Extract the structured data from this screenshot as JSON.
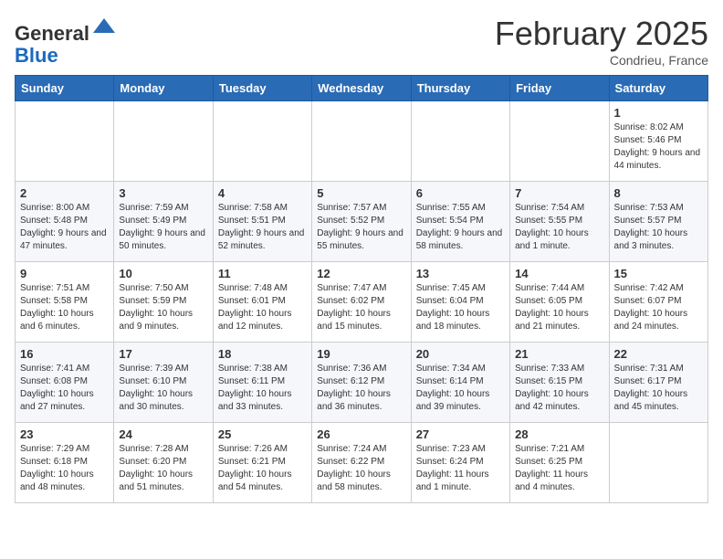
{
  "header": {
    "logo_line1": "General",
    "logo_line2": "Blue",
    "month": "February 2025",
    "location": "Condrieu, France"
  },
  "days_of_week": [
    "Sunday",
    "Monday",
    "Tuesday",
    "Wednesday",
    "Thursday",
    "Friday",
    "Saturday"
  ],
  "weeks": [
    [
      {
        "day": "",
        "info": ""
      },
      {
        "day": "",
        "info": ""
      },
      {
        "day": "",
        "info": ""
      },
      {
        "day": "",
        "info": ""
      },
      {
        "day": "",
        "info": ""
      },
      {
        "day": "",
        "info": ""
      },
      {
        "day": "1",
        "info": "Sunrise: 8:02 AM\nSunset: 5:46 PM\nDaylight: 9 hours and 44 minutes."
      }
    ],
    [
      {
        "day": "2",
        "info": "Sunrise: 8:00 AM\nSunset: 5:48 PM\nDaylight: 9 hours and 47 minutes."
      },
      {
        "day": "3",
        "info": "Sunrise: 7:59 AM\nSunset: 5:49 PM\nDaylight: 9 hours and 50 minutes."
      },
      {
        "day": "4",
        "info": "Sunrise: 7:58 AM\nSunset: 5:51 PM\nDaylight: 9 hours and 52 minutes."
      },
      {
        "day": "5",
        "info": "Sunrise: 7:57 AM\nSunset: 5:52 PM\nDaylight: 9 hours and 55 minutes."
      },
      {
        "day": "6",
        "info": "Sunrise: 7:55 AM\nSunset: 5:54 PM\nDaylight: 9 hours and 58 minutes."
      },
      {
        "day": "7",
        "info": "Sunrise: 7:54 AM\nSunset: 5:55 PM\nDaylight: 10 hours and 1 minute."
      },
      {
        "day": "8",
        "info": "Sunrise: 7:53 AM\nSunset: 5:57 PM\nDaylight: 10 hours and 3 minutes."
      }
    ],
    [
      {
        "day": "9",
        "info": "Sunrise: 7:51 AM\nSunset: 5:58 PM\nDaylight: 10 hours and 6 minutes."
      },
      {
        "day": "10",
        "info": "Sunrise: 7:50 AM\nSunset: 5:59 PM\nDaylight: 10 hours and 9 minutes."
      },
      {
        "day": "11",
        "info": "Sunrise: 7:48 AM\nSunset: 6:01 PM\nDaylight: 10 hours and 12 minutes."
      },
      {
        "day": "12",
        "info": "Sunrise: 7:47 AM\nSunset: 6:02 PM\nDaylight: 10 hours and 15 minutes."
      },
      {
        "day": "13",
        "info": "Sunrise: 7:45 AM\nSunset: 6:04 PM\nDaylight: 10 hours and 18 minutes."
      },
      {
        "day": "14",
        "info": "Sunrise: 7:44 AM\nSunset: 6:05 PM\nDaylight: 10 hours and 21 minutes."
      },
      {
        "day": "15",
        "info": "Sunrise: 7:42 AM\nSunset: 6:07 PM\nDaylight: 10 hours and 24 minutes."
      }
    ],
    [
      {
        "day": "16",
        "info": "Sunrise: 7:41 AM\nSunset: 6:08 PM\nDaylight: 10 hours and 27 minutes."
      },
      {
        "day": "17",
        "info": "Sunrise: 7:39 AM\nSunset: 6:10 PM\nDaylight: 10 hours and 30 minutes."
      },
      {
        "day": "18",
        "info": "Sunrise: 7:38 AM\nSunset: 6:11 PM\nDaylight: 10 hours and 33 minutes."
      },
      {
        "day": "19",
        "info": "Sunrise: 7:36 AM\nSunset: 6:12 PM\nDaylight: 10 hours and 36 minutes."
      },
      {
        "day": "20",
        "info": "Sunrise: 7:34 AM\nSunset: 6:14 PM\nDaylight: 10 hours and 39 minutes."
      },
      {
        "day": "21",
        "info": "Sunrise: 7:33 AM\nSunset: 6:15 PM\nDaylight: 10 hours and 42 minutes."
      },
      {
        "day": "22",
        "info": "Sunrise: 7:31 AM\nSunset: 6:17 PM\nDaylight: 10 hours and 45 minutes."
      }
    ],
    [
      {
        "day": "23",
        "info": "Sunrise: 7:29 AM\nSunset: 6:18 PM\nDaylight: 10 hours and 48 minutes."
      },
      {
        "day": "24",
        "info": "Sunrise: 7:28 AM\nSunset: 6:20 PM\nDaylight: 10 hours and 51 minutes."
      },
      {
        "day": "25",
        "info": "Sunrise: 7:26 AM\nSunset: 6:21 PM\nDaylight: 10 hours and 54 minutes."
      },
      {
        "day": "26",
        "info": "Sunrise: 7:24 AM\nSunset: 6:22 PM\nDaylight: 10 hours and 58 minutes."
      },
      {
        "day": "27",
        "info": "Sunrise: 7:23 AM\nSunset: 6:24 PM\nDaylight: 11 hours and 1 minute."
      },
      {
        "day": "28",
        "info": "Sunrise: 7:21 AM\nSunset: 6:25 PM\nDaylight: 11 hours and 4 minutes."
      },
      {
        "day": "",
        "info": ""
      }
    ]
  ]
}
